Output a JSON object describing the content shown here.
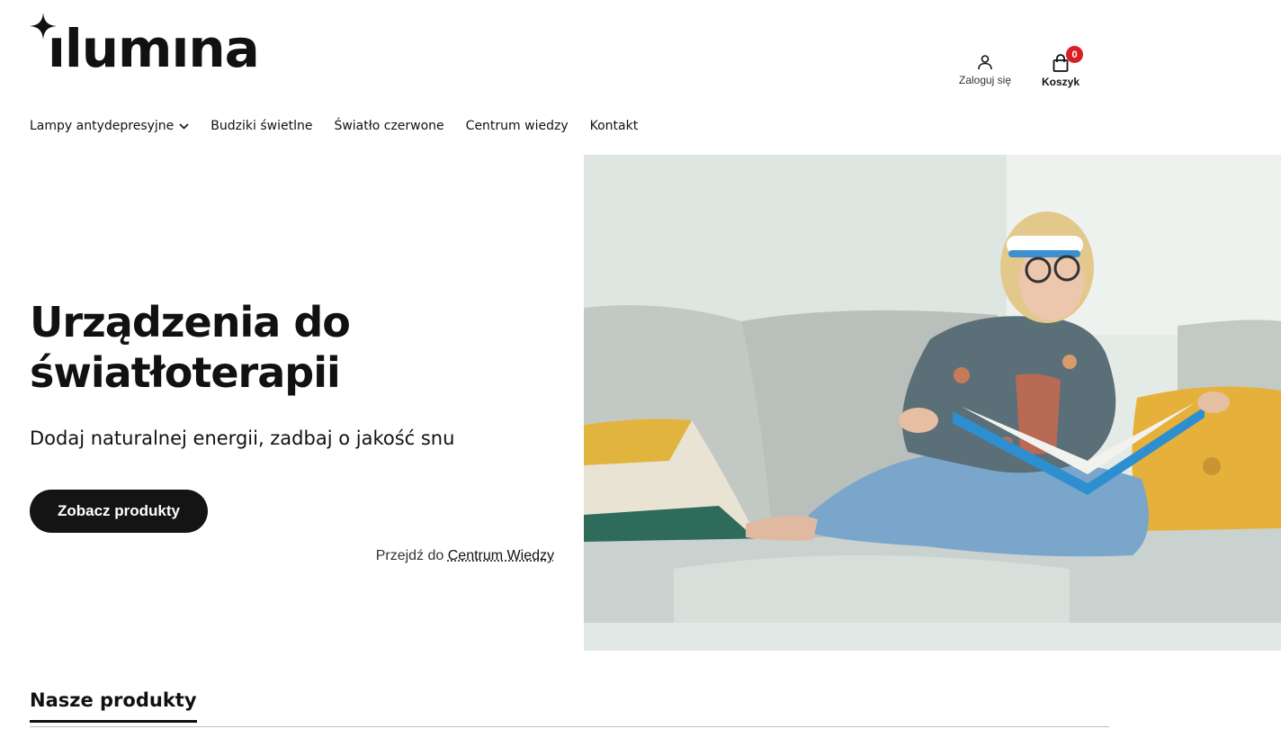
{
  "brand": {
    "logo_text": "ılumına"
  },
  "header": {
    "login_label": "Zaloguj się",
    "cart_label": "Koszyk",
    "cart_count": "0"
  },
  "nav": {
    "items": [
      {
        "label": "Lampy antydepresyjne",
        "has_dropdown": true
      },
      {
        "label": "Budziki świetlne"
      },
      {
        "label": "Światło czerwone"
      },
      {
        "label": "Centrum wiedzy"
      },
      {
        "label": "Kontakt"
      }
    ]
  },
  "hero": {
    "title_line1": "Urządzenia do",
    "title_line2": "światłoterapii",
    "subtitle": "Dodaj naturalnej energii, zadbaj o jakość snu",
    "cta_label": "Zobacz produkty",
    "kb_prefix": "Przejdź do",
    "kb_link": "Centrum Wiedzy"
  },
  "products": {
    "section_title": "Nasze produkty"
  },
  "colors": {
    "text": "#111111",
    "button_bg": "#141414",
    "badge": "#d81f26",
    "accent_yellow": "#e8b73a"
  }
}
